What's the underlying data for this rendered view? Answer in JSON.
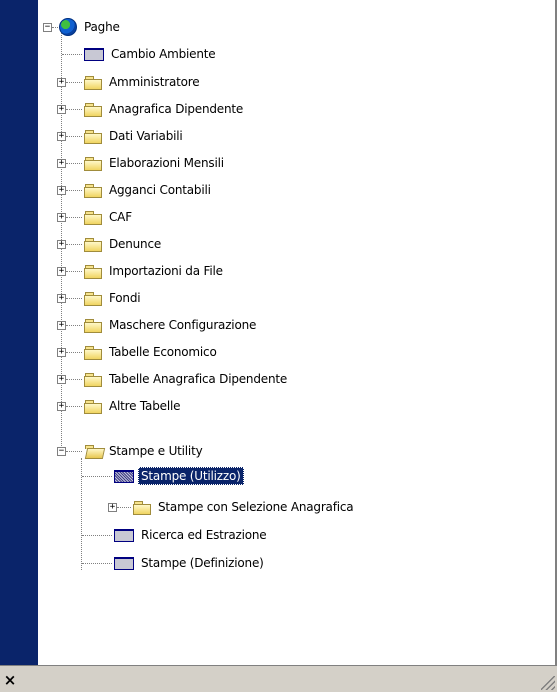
{
  "tree": {
    "root": {
      "label": "Paghe",
      "icon": "globe-icon",
      "expanded": true
    },
    "items": [
      {
        "label": "Cambio Ambiente",
        "icon": "form-icon",
        "expandable": false
      },
      {
        "label": "Amministratore",
        "icon": "folder-icon",
        "expandable": true
      },
      {
        "label": "Anagrafica Dipendente",
        "icon": "folder-icon",
        "expandable": true
      },
      {
        "label": "Dati Variabili",
        "icon": "folder-icon",
        "expandable": true
      },
      {
        "label": "Elaborazioni Mensili",
        "icon": "folder-icon",
        "expandable": true
      },
      {
        "label": "Agganci Contabili",
        "icon": "folder-icon",
        "expandable": true
      },
      {
        "label": "CAF",
        "icon": "folder-icon",
        "expandable": true
      },
      {
        "label": "Denunce",
        "icon": "folder-icon",
        "expandable": true
      },
      {
        "label": "Importazioni da File",
        "icon": "folder-icon",
        "expandable": true
      },
      {
        "label": "Fondi",
        "icon": "folder-icon",
        "expandable": true
      },
      {
        "label": "Maschere Configurazione",
        "icon": "folder-icon",
        "expandable": true
      },
      {
        "label": "Tabelle Economico",
        "icon": "folder-icon",
        "expandable": true
      },
      {
        "label": "Tabelle Anagrafica Dipendente",
        "icon": "folder-icon",
        "expandable": true
      },
      {
        "label": "Altre Tabelle",
        "icon": "folder-icon",
        "expandable": true
      },
      {
        "label": "Stampe e Utility",
        "icon": "open-folder-icon",
        "expandable": true,
        "expanded": true
      }
    ],
    "children": [
      {
        "label": "Stampe (Utilizzo)",
        "icon": "form-icon",
        "selected": true
      },
      {
        "label": "Stampe con Selezione Anagrafica",
        "icon": "folder-icon",
        "expandable": true
      },
      {
        "label": "Ricerca ed Estrazione",
        "icon": "form-icon"
      },
      {
        "label": "Stampe (Definizione)",
        "icon": "form-icon"
      }
    ]
  },
  "status_bar": {
    "close_glyph": "×"
  },
  "colors": {
    "sidebar": "#0a246a",
    "selection": "#0a246a",
    "background": "#d4d0c8"
  }
}
